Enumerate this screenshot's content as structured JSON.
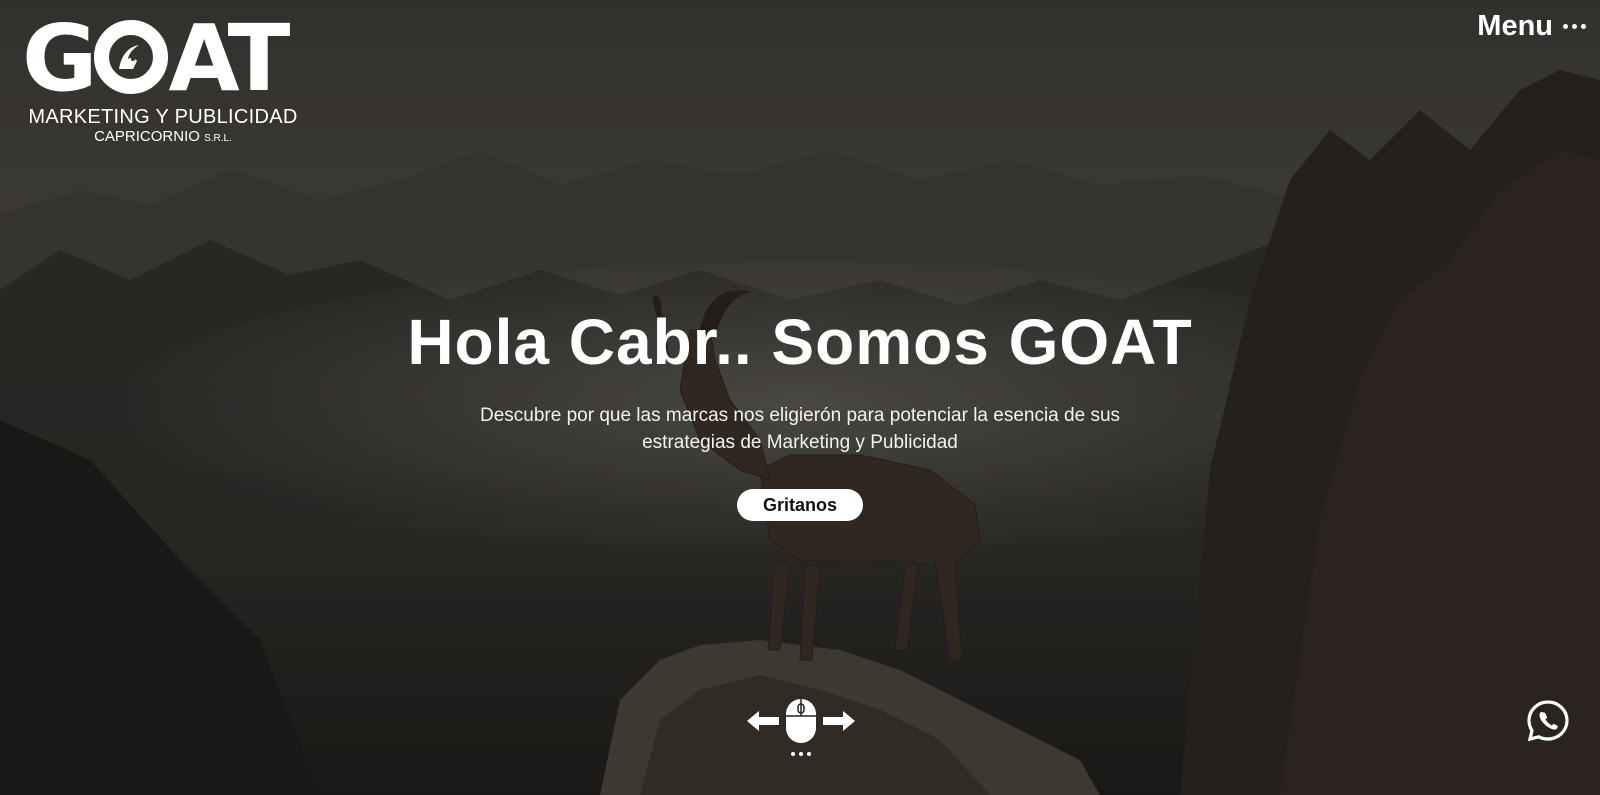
{
  "logo": {
    "wordmark": "GOAT",
    "line1": "MARKETING Y PUBLICIDAD",
    "line2": "CAPRICORNIO",
    "line2_suffix": "S.R.L."
  },
  "menu": {
    "label": "Menu",
    "icon": "more-dots-icon"
  },
  "hero": {
    "headline": "Hola Cabr.. Somos GOAT",
    "subtitle": "Descubre por que las marcas nos eligierón para potenciar la esencia de sus estrategias de Marketing y Publicidad",
    "cta_label": "Gritanos"
  },
  "scroll_hint": {
    "icons": [
      "arrow-left-icon",
      "mouse-icon",
      "arrow-right-icon",
      "ellipsis-icon"
    ]
  },
  "whatsapp": {
    "icon": "whatsapp-icon",
    "color": "#ffffff"
  },
  "colors": {
    "text": "#ffffff",
    "button_bg": "#ffffff",
    "button_text": "#111111"
  }
}
